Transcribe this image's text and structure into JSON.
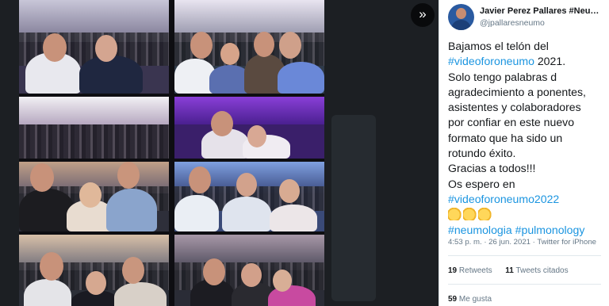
{
  "tweet": {
    "display_name": "Javier Perez Pallares #Neu…",
    "handle": "@jpallaresneumo",
    "body": {
      "line1": "Bajamos el telón del",
      "hashtag1": "#videoforoneumo",
      "line2_suffix": " 2021.",
      "line3": "Solo tengo palabras d",
      "line4": "agradecimiento a ponentes,",
      "line5": "asistentes y colaboradores",
      "line6": "por confiar en este nuevo",
      "line7": "formato que ha sido un",
      "line8": "rotundo éxito.",
      "line9": "Gracias a todos!!!",
      "line10": "Os espero en",
      "hashtag2": "#videoforoneumo2022",
      "hashtag3": "#neumologia",
      "hashtag4": "#pulmonology"
    },
    "timestamp": "4:53 p. m. · 26 jun. 2021 · Twitter for iPhone",
    "retweets_count": "19",
    "retweets_label": "Retweets",
    "quotes_count": "11",
    "quotes_label": "Tweets citados",
    "likes_count": "59",
    "likes_label": "Me gusta"
  },
  "icons": {
    "next": "chevron-double-right-icon",
    "emoji": "clapping-hands-icon"
  },
  "colors": {
    "hashtag": "#1b95e0",
    "text": "#14171a",
    "secondary": "#657786"
  }
}
